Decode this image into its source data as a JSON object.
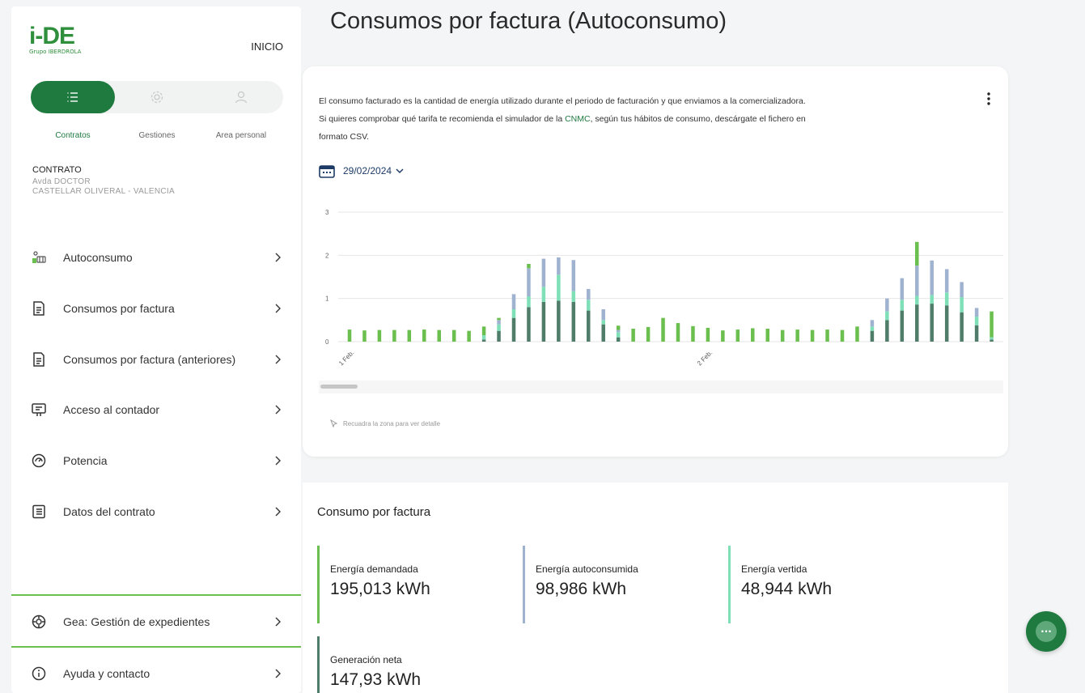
{
  "sidebar": {
    "logo_text": "i-DE",
    "logo_sub": "Grupo IBERDROLA",
    "inicio": "INICIO",
    "tabs": [
      {
        "label": "Contratos",
        "icon": "list-icon",
        "active": true
      },
      {
        "label": "Gestiones",
        "icon": "gear-icon",
        "active": false
      },
      {
        "label": "Area personal",
        "icon": "person-icon",
        "active": false
      }
    ],
    "contract": {
      "title": "CONTRATO",
      "line1": "Avda DOCTOR",
      "line2": "CASTELLAR OLIVERAL - VALENCIA"
    },
    "menu": [
      {
        "label": "Autoconsumo",
        "icon": "solar-panel-icon"
      },
      {
        "label": "Consumos por factura",
        "icon": "invoice-icon"
      },
      {
        "label": "Consumos por factura (anteriores)",
        "icon": "invoice-icon"
      },
      {
        "label": "Acceso al contador",
        "icon": "meter-icon"
      },
      {
        "label": "Potencia",
        "icon": "gauge-icon"
      },
      {
        "label": "Datos del contrato",
        "icon": "document-icon"
      }
    ],
    "bottom": [
      {
        "label": "Gea: Gestión de expedientes",
        "icon": "file-gear-icon"
      },
      {
        "label": "Ayuda y contacto",
        "icon": "info-icon"
      }
    ]
  },
  "main": {
    "title": "Consumos por factura (Autoconsumo)",
    "desc1": "El consumo facturado es la cantidad de energía utilizado durante el periodo de facturación y que enviamos a la comercializadora.",
    "desc2_pre": "Si quieres comprobar qué tarifa te recomienda el simulador de la ",
    "desc2_link": "CNMC",
    "desc2_post": ", según tus hábitos de consumo, descárgate el fichero en",
    "desc3": "formato CSV.",
    "date": "29/02/2024",
    "hint": "Recuadra la zona para ver detalle",
    "summary_title": "Consumo por factura",
    "metrics": [
      {
        "label": "Energía demandada",
        "value": "195,013 kWh",
        "color": "#6bbf4e"
      },
      {
        "label": "Energía autoconsumida",
        "value": "98,986 kWh",
        "color": "#9fb3d1"
      },
      {
        "label": "Energía vertida",
        "value": "48,944 kWh",
        "color": "#7fe0b8"
      },
      {
        "label": "Generación neta",
        "value": "147,93 kWh",
        "color": "#4f7d6a"
      }
    ],
    "chat_icon": "chat-icon"
  },
  "chart_data": {
    "type": "bar",
    "stacked": true,
    "y_ticks": [
      "0",
      "1",
      "2",
      "3"
    ],
    "ylim": [
      0,
      3
    ],
    "x_tick_labels": [
      {
        "label": "1 Feb.",
        "index": 0
      },
      {
        "label": "2 Feb.",
        "index": 24
      }
    ],
    "colors": {
      "dark": "#4f7d6a",
      "aqua": "#7fe0b8",
      "blue": "#9fb3d1",
      "green": "#6bbf4e"
    },
    "series": [
      {
        "key": "dark",
        "values": [
          0,
          0,
          0,
          0,
          0,
          0,
          0,
          0,
          0,
          0.05,
          0.25,
          0.55,
          0.8,
          0.92,
          0.95,
          0.92,
          0.72,
          0.4,
          0.1,
          0,
          0,
          0,
          0,
          0,
          0,
          0,
          0,
          0,
          0,
          0,
          0,
          0,
          0,
          0,
          0,
          0.25,
          0.5,
          0.72,
          0.86,
          0.88,
          0.84,
          0.68,
          0.38,
          0.05
        ]
      },
      {
        "key": "aqua",
        "values": [
          0,
          0,
          0,
          0,
          0,
          0,
          0,
          0,
          0,
          0.1,
          0.15,
          0.2,
          0.25,
          0.35,
          0.6,
          0.25,
          0.25,
          0.1,
          0.12,
          0,
          0,
          0,
          0,
          0,
          0,
          0,
          0,
          0,
          0,
          0,
          0,
          0,
          0,
          0,
          0,
          0.1,
          0.2,
          0.25,
          0.2,
          0.2,
          0.3,
          0.35,
          0.2,
          0.05
        ]
      },
      {
        "key": "blue",
        "values": [
          0,
          0,
          0,
          0,
          0,
          0,
          0,
          0,
          0,
          0,
          0.1,
          0.35,
          0.65,
          0.65,
          0.4,
          0.72,
          0.25,
          0.25,
          0.05,
          0,
          0,
          0,
          0,
          0,
          0,
          0,
          0,
          0,
          0,
          0,
          0,
          0,
          0,
          0,
          0,
          0.15,
          0.3,
          0.5,
          0.7,
          0.8,
          0.54,
          0.35,
          0.2,
          0
        ]
      },
      {
        "key": "green",
        "values": [
          0.28,
          0.26,
          0.27,
          0.27,
          0.27,
          0.28,
          0.27,
          0.27,
          0.25,
          0.2,
          0.05,
          0,
          0.1,
          0,
          0,
          0,
          0,
          0,
          0.1,
          0.3,
          0.34,
          0.55,
          0.43,
          0.36,
          0.32,
          0.26,
          0.28,
          0.31,
          0.3,
          0.27,
          0.28,
          0.27,
          0.28,
          0.27,
          0.35,
          0,
          0,
          0,
          0.55,
          0,
          0,
          0,
          0,
          0.6
        ]
      }
    ]
  }
}
